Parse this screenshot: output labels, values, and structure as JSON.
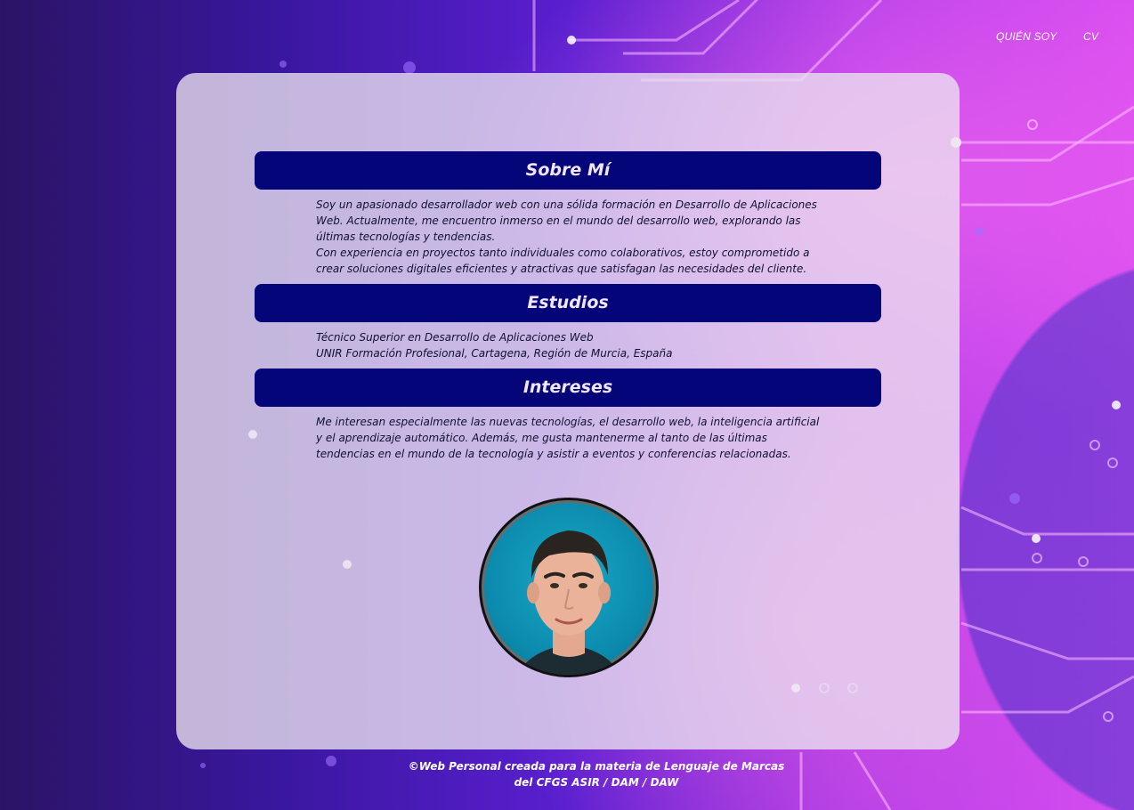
{
  "nav": {
    "items": [
      {
        "label": "QUIÉN SOY"
      },
      {
        "label": "CV"
      }
    ]
  },
  "sections": [
    {
      "title": "Sobre Mí",
      "paragraphs": [
        "Soy un apasionado desarrollador web con una sólida formación en Desarrollo de Aplicaciones Web. Actualmente, me encuentro inmerso en el mundo del desarrollo web, explorando las últimas tecnologías y tendencias.",
        "Con experiencia en proyectos tanto individuales como colaborativos, estoy comprometido a crear soluciones digitales eficientes y atractivas que satisfagan las necesidades del cliente."
      ]
    },
    {
      "title": "Estudios",
      "paragraphs": [
        "Técnico Superior en Desarrollo de Aplicaciones Web",
        "UNIR Formación Profesional, Cartagena, Región de Murcia, España"
      ]
    },
    {
      "title": "Intereses",
      "paragraphs": [
        "Me interesan especialmente las nuevas tecnologías, el desarrollo web, la inteligencia artificial y el aprendizaje automático. Además, me gusta mantenerme al tanto de las últimas tendencias en el mundo de la tecnología y asistir a eventos y conferencias relacionadas."
      ]
    }
  ],
  "footer": {
    "line1": "©Web Personal creada para la materia de Lenguaje de Marcas",
    "line2": "del CFGS ASIR / DAM / DAW"
  },
  "colors": {
    "header_bg": "#05057a",
    "header_text": "#f0e6ff",
    "card_bg": "#ece4f0",
    "photo_bg": "#1aa7c7"
  },
  "icons": {
    "profile_photo": "avatar-photo"
  }
}
